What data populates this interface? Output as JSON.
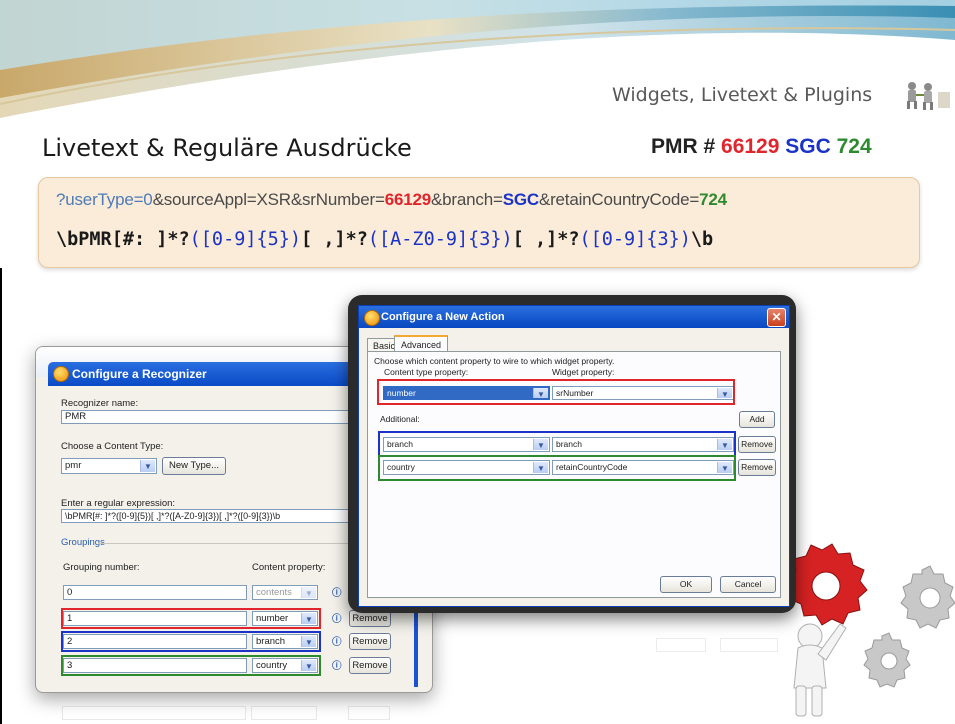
{
  "slide": {
    "subtitle": "Widgets, Livetext & Plugins",
    "title": "Livetext & Reguläre Ausdrücke",
    "pmr": {
      "prefix": "PMR # ",
      "number": "66129",
      "sgc": "SGC",
      "code": "724"
    },
    "url": {
      "part1": "?userType=0",
      "part2": "&sourceAppl=XSR&srNumber=",
      "srnumber": "66129",
      "part3": "&branch=",
      "branch": "SGC",
      "part4": "&retainCountryCode=",
      "country": "724"
    },
    "regex": {
      "p1": "\\bPMR[#: ]*?",
      "g1": "([0-9]{5})",
      "p2": "[ ,]*?",
      "g2": "([A-Z0-9]{3})",
      "p3": "[ ,]*?",
      "g3": "([0-9]{3})",
      "p4": "\\b"
    },
    "colors": {
      "red": "#e0252c",
      "blue": "#1c33c8",
      "green": "#2e8a2e"
    }
  },
  "recognizer": {
    "title": "Configure a Recognizer",
    "name_label": "Recognizer name:",
    "name_value": "PMR",
    "content_type_label": "Choose a Content Type:",
    "content_type_value": "pmr",
    "new_type_button": "New Type...",
    "regex_label": "Enter a regular expression:",
    "regex_value": "\\bPMR[#: ]*?([0-9]{5})[ ,]*?([A-Z0-9]{3})[ ,]*?([0-9]{3})\\b",
    "groupings_label": "Groupings",
    "grouping_number_header": "Grouping number:",
    "content_property_header": "Content property:",
    "rows": [
      {
        "number": "0",
        "property": "contents",
        "button": ""
      },
      {
        "number": "1",
        "property": "number",
        "button": "Remove"
      },
      {
        "number": "2",
        "property": "branch",
        "button": "Remove"
      },
      {
        "number": "3",
        "property": "country",
        "button": "Remove"
      }
    ]
  },
  "action": {
    "title": "Configure a New Action",
    "tabs": [
      "Basic",
      "Advanced"
    ],
    "description": "Choose which content property to wire to which widget property.",
    "content_type_property_label": "Content type property:",
    "widget_property_label": "Widget property:",
    "main_row": {
      "content": "number",
      "widget": "srNumber"
    },
    "additional_label": "Additional:",
    "add_button": "Add",
    "additional_rows": [
      {
        "content": "branch",
        "widget": "branch",
        "button": "Remove"
      },
      {
        "content": "country",
        "widget": "retainCountryCode",
        "button": "Remove"
      }
    ],
    "ok_button": "OK",
    "cancel_button": "Cancel"
  }
}
